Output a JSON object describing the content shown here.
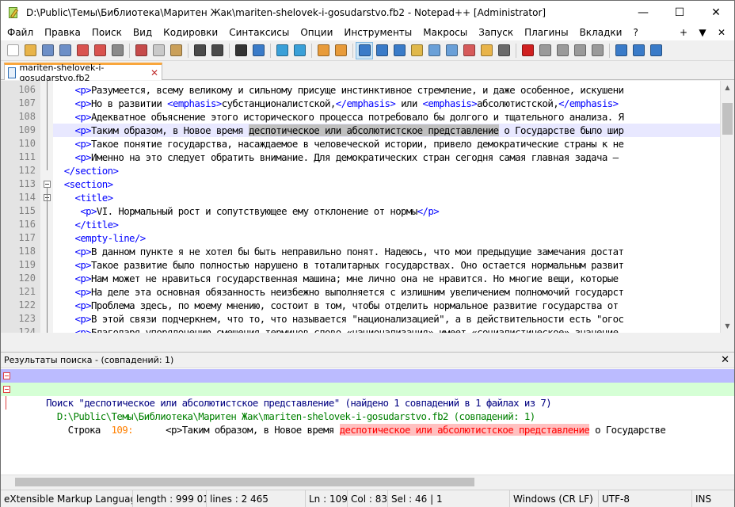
{
  "window": {
    "title": "D:\\Public\\Темы\\Библиотека\\Маритен Жак\\mariten-shelovek-i-gosudarstvo.fb2 - Notepad++ [Administrator]",
    "minimize": "—",
    "maximize": "☐",
    "close": "✕"
  },
  "menu": {
    "items": [
      "Файл",
      "Правка",
      "Поиск",
      "Вид",
      "Кодировки",
      "Синтаксисы",
      "Опции",
      "Инструменты",
      "Макросы",
      "Запуск",
      "Плагины",
      "Вкладки",
      "?"
    ],
    "right": [
      "+",
      "▼",
      "✕"
    ]
  },
  "toolbar": {
    "icons": [
      {
        "name": "new-file-icon",
        "color": "#ffffff"
      },
      {
        "name": "open-file-icon",
        "color": "#e8b44a"
      },
      {
        "name": "save-icon",
        "color": "#6d8fc7"
      },
      {
        "name": "save-all-icon",
        "color": "#6d8fc7"
      },
      {
        "name": "close-icon",
        "color": "#d9534f"
      },
      {
        "name": "close-all-icon",
        "color": "#d9534f"
      },
      {
        "name": "print-icon",
        "color": "#8a8a8a"
      },
      {
        "name": "sep",
        "color": ""
      },
      {
        "name": "cut-icon",
        "color": "#c64b4b"
      },
      {
        "name": "copy-icon",
        "color": "#c9c9c9"
      },
      {
        "name": "paste-icon",
        "color": "#caa05a"
      },
      {
        "name": "sep",
        "color": ""
      },
      {
        "name": "undo-icon",
        "color": "#4a4a4a"
      },
      {
        "name": "redo-icon",
        "color": "#4a4a4a"
      },
      {
        "name": "sep",
        "color": ""
      },
      {
        "name": "find-icon",
        "color": "#333333"
      },
      {
        "name": "replace-icon",
        "color": "#3a7bc8"
      },
      {
        "name": "sep",
        "color": ""
      },
      {
        "name": "zoom-in-icon",
        "color": "#3aa0d8"
      },
      {
        "name": "zoom-out-icon",
        "color": "#3aa0d8"
      },
      {
        "name": "sep",
        "color": ""
      },
      {
        "name": "sync-vertical-icon",
        "color": "#e89b3a"
      },
      {
        "name": "sync-horizontal-icon",
        "color": "#e89b3a"
      },
      {
        "name": "sep",
        "color": ""
      },
      {
        "name": "word-wrap-icon",
        "color": "#3a7bc8"
      },
      {
        "name": "show-all-chars-icon",
        "color": "#3a7bc8"
      },
      {
        "name": "indent-guide-icon",
        "color": "#3a7bc8"
      },
      {
        "name": "udl-icon",
        "color": "#e0b84a"
      },
      {
        "name": "doc-map-icon",
        "color": "#6aa0d8"
      },
      {
        "name": "doc-list-icon",
        "color": "#6aa0d8"
      },
      {
        "name": "function-list-icon",
        "color": "#d65a5a"
      },
      {
        "name": "folder-workspace-icon",
        "color": "#e8b44a"
      },
      {
        "name": "monitoring-icon",
        "color": "#6a6a6a"
      },
      {
        "name": "sep",
        "color": ""
      },
      {
        "name": "record-macro-icon",
        "color": "#d02020"
      },
      {
        "name": "stop-macro-icon",
        "color": "#9a9a9a"
      },
      {
        "name": "play-macro-icon",
        "color": "#9a9a9a"
      },
      {
        "name": "play-multiple-icon",
        "color": "#9a9a9a"
      },
      {
        "name": "save-macro-icon",
        "color": "#9a9a9a"
      },
      {
        "name": "sep",
        "color": ""
      },
      {
        "name": "spell-check-icon",
        "color": "#3a7bc8"
      },
      {
        "name": "spell-settings-icon",
        "color": "#3a7bc8"
      },
      {
        "name": "spell-next-icon",
        "color": "#3a7bc8"
      }
    ],
    "active_index": 24
  },
  "tab": {
    "label": "mariten-shelovek-i-gosudarstvo.fb2",
    "close": "✕"
  },
  "editor": {
    "caret_line": 109,
    "lines": [
      {
        "n": "106",
        "indent": "    ",
        "parts": [
          [
            "tag",
            "<p>"
          ],
          [
            "txt",
            "Разумеется, всему великому и сильному присуще инстинктивное стремление, и даже особенное, искушени"
          ]
        ]
      },
      {
        "n": "107",
        "indent": "    ",
        "parts": [
          [
            "tag",
            "<p>"
          ],
          [
            "txt",
            "Но в развитии "
          ],
          [
            "tag",
            "<emphasis>"
          ],
          [
            "txt",
            "субстанционалистской,"
          ],
          [
            "tag",
            "</emphasis>"
          ],
          [
            "txt",
            " или "
          ],
          [
            "tag",
            "<emphasis>"
          ],
          [
            "txt",
            "абсолютистской,"
          ],
          [
            "tag",
            "</emphasis>"
          ],
          [
            "txt",
            " "
          ]
        ]
      },
      {
        "n": "108",
        "indent": "    ",
        "parts": [
          [
            "tag",
            "<p>"
          ],
          [
            "txt",
            "Адекватное объяснение этого исторического процесса потребовало бы долгого и тщательного анализа. Я"
          ]
        ]
      },
      {
        "n": "109",
        "indent": "    ",
        "parts": [
          [
            "tag",
            "<p>"
          ],
          [
            "txt",
            "Таким образом, в Новое время "
          ],
          [
            "hl",
            "деспотическое или абсолютистское представление"
          ],
          [
            "txt",
            " о Государстве было шир"
          ]
        ]
      },
      {
        "n": "110",
        "indent": "    ",
        "parts": [
          [
            "tag",
            "<p>"
          ],
          [
            "txt",
            "Такое понятие государства, насаждаемое в человеческой истории, привело демократические страны к не"
          ]
        ]
      },
      {
        "n": "111",
        "indent": "    ",
        "parts": [
          [
            "tag",
            "<p>"
          ],
          [
            "txt",
            "Именно на это следует обратить внимание. Для демократических стран сегодня самая главная задача —"
          ]
        ]
      },
      {
        "n": "112",
        "indent": "  ",
        "parts": [
          [
            "tag",
            "</section>"
          ]
        ]
      },
      {
        "n": "113",
        "indent": "  ",
        "parts": [
          [
            "tag",
            "<section>"
          ]
        ]
      },
      {
        "n": "114",
        "indent": "    ",
        "parts": [
          [
            "tag",
            "<title>"
          ]
        ]
      },
      {
        "n": "115",
        "indent": "     ",
        "parts": [
          [
            "tag",
            "<p>"
          ],
          [
            "txt",
            "VI. Нормальный рост и сопутствующее ему отклонение от нормы"
          ],
          [
            "tag",
            "</p>"
          ]
        ]
      },
      {
        "n": "116",
        "indent": "    ",
        "parts": [
          [
            "tag",
            "</title>"
          ]
        ]
      },
      {
        "n": "117",
        "indent": "    ",
        "parts": [
          [
            "tag",
            "<empty-line/>"
          ]
        ]
      },
      {
        "n": "118",
        "indent": "    ",
        "parts": [
          [
            "tag",
            "<p>"
          ],
          [
            "txt",
            "В данном пункте я не хотел бы быть неправильно понят. Надеюсь, что мои предыдущие замечания достат"
          ]
        ]
      },
      {
        "n": "119",
        "indent": "    ",
        "parts": [
          [
            "tag",
            "<p>"
          ],
          [
            "txt",
            "Такое развитие было полностью нарушено в тоталитарных государствах. Оно остается нормальным развит"
          ]
        ]
      },
      {
        "n": "120",
        "indent": "    ",
        "parts": [
          [
            "tag",
            "<p>"
          ],
          [
            "txt",
            "Нам может не нравиться государственная машина; мне лично она не нравится. Но многие вещи, которые "
          ]
        ]
      },
      {
        "n": "121",
        "indent": "    ",
        "parts": [
          [
            "tag",
            "<p>"
          ],
          [
            "txt",
            "На деле эта основная обязанность неизбежно выполняется с излишним увеличением полномочий государст"
          ]
        ]
      },
      {
        "n": "122",
        "indent": "    ",
        "parts": [
          [
            "tag",
            "<p>"
          ],
          [
            "txt",
            "Проблема здесь, по моему мнению, состоит в том, чтобы отделить нормальное развитие государства от "
          ]
        ]
      },
      {
        "n": "123",
        "indent": "    ",
        "parts": [
          [
            "tag",
            "<p>"
          ],
          [
            "txt",
            "В этой связи подчеркнем, что то, что называется \"национализацией\", а в действительности есть \"огос"
          ]
        ]
      },
      {
        "n": "124",
        "indent": "    ",
        "parts": [
          [
            "tag",
            "<p>"
          ],
          [
            "txt",
            "Благодаря упорядочению смещения терминов слово «национализация» имеет «социалистическое» значение"
          ]
        ]
      }
    ]
  },
  "results": {
    "header": "Результаты поиска - (совпадений: 1)",
    "close": "✕",
    "search_line": "Поиск \"деспотическое или абсолютистское представление\" (найдено 1 совпадений в 1 файлах из 7)",
    "file_line": "  D:\\Public\\Темы\\Библиотека\\Маритен Жак\\mariten-shelovek-i-gosudarstvo.fb2 (совпадений: 1)",
    "hit_prefix": "    Строка  ",
    "hit_line_no": "109:",
    "hit_pre": "      <p>Таким образом, в Новое время ",
    "hit_match": "деспотическое или абсолютистское представление",
    "hit_post": " о Государстве"
  },
  "status": {
    "language": "eXtensible Markup Language fi",
    "length": "length : 999 017",
    "lines": "lines : 2 465",
    "ln": "Ln : 109",
    "col": "Col : 83",
    "sel": "Sel : 46 | 1",
    "eol": "Windows (CR LF)",
    "encoding": "UTF-8",
    "mode": "INS"
  }
}
